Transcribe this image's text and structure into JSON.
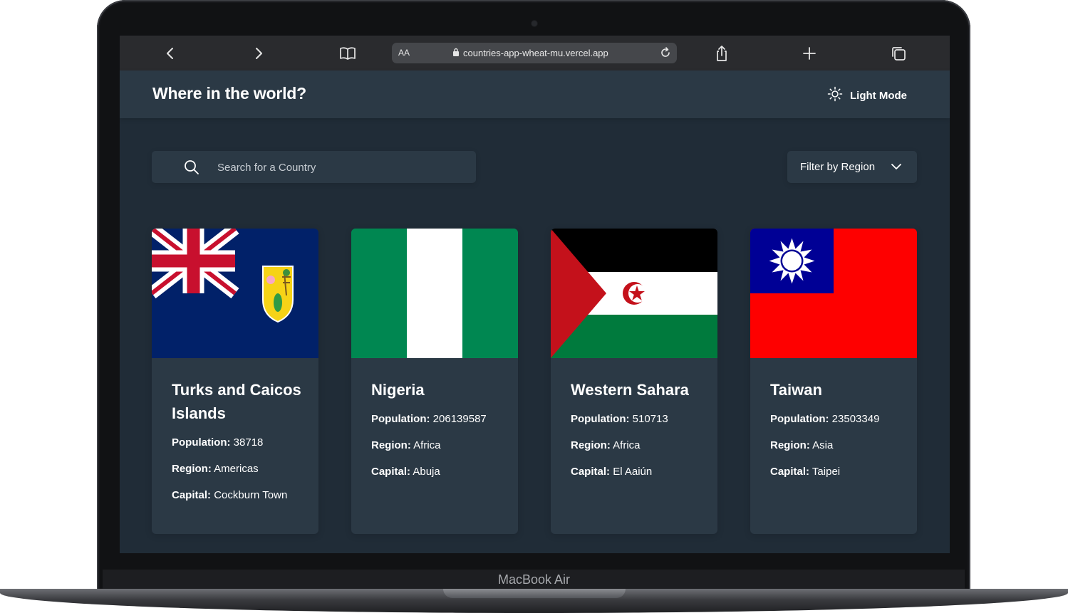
{
  "browser": {
    "url": "countries-app-wheat-mu.vercel.app",
    "text_size_label": "AA"
  },
  "header": {
    "title": "Where in the world?",
    "mode_label": "Light Mode"
  },
  "search": {
    "placeholder": "Search for a Country",
    "value": ""
  },
  "filter": {
    "label": "Filter by Region"
  },
  "fact_labels": {
    "population": "Population:",
    "region": "Region:",
    "capital": "Capital:"
  },
  "countries": [
    {
      "name": "Turks and Caicos Islands",
      "population": "38718",
      "region": "Americas",
      "capital": "Cockburn Town",
      "flag": "turks-and-caicos-flag"
    },
    {
      "name": "Nigeria",
      "population": "206139587",
      "region": "Africa",
      "capital": "Abuja",
      "flag": "nigeria-flag"
    },
    {
      "name": "Western Sahara",
      "population": "510713",
      "region": "Africa",
      "capital": "El Aaiún",
      "flag": "western-sahara-flag"
    },
    {
      "name": "Taiwan",
      "population": "23503349",
      "region": "Asia",
      "capital": "Taipei",
      "flag": "taiwan-flag"
    }
  ],
  "device": {
    "label": "MacBook Air"
  },
  "colors": {
    "background": "#202c37",
    "elements": "#2b3945",
    "text": "#ffffff"
  }
}
